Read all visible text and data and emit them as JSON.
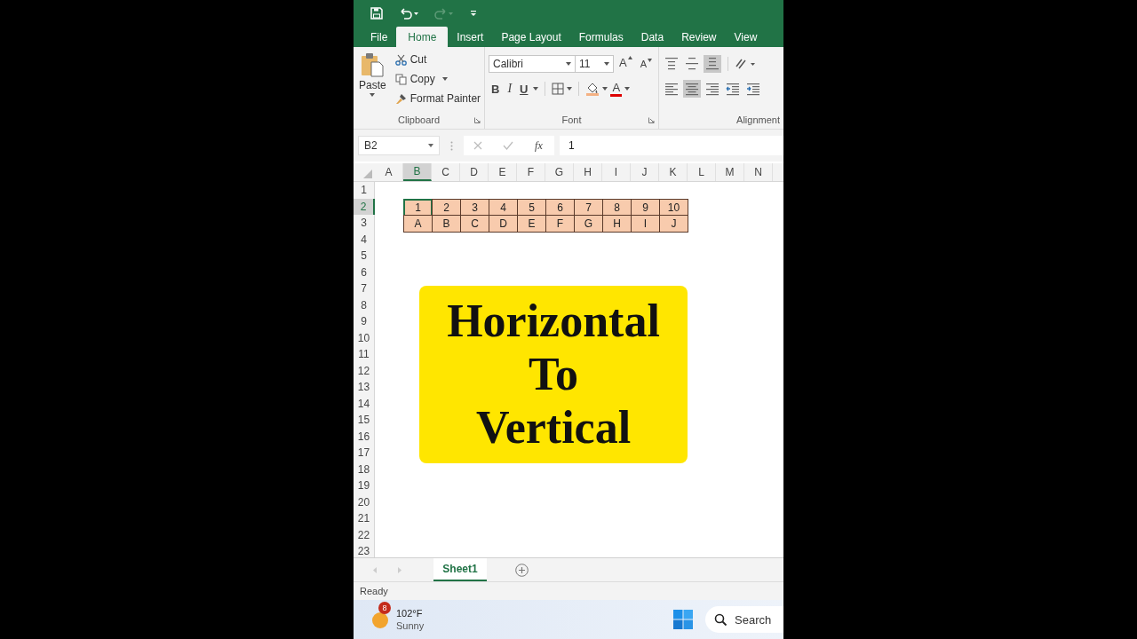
{
  "tabs": [
    {
      "label": "File",
      "selected": false
    },
    {
      "label": "Home",
      "selected": true
    },
    {
      "label": "Insert",
      "selected": false
    },
    {
      "label": "Page Layout",
      "selected": false
    },
    {
      "label": "Formulas",
      "selected": false
    },
    {
      "label": "Data",
      "selected": false
    },
    {
      "label": "Review",
      "selected": false
    },
    {
      "label": "View",
      "selected": false
    }
  ],
  "clipboard": {
    "paste": "Paste",
    "cut": "Cut",
    "copy": "Copy",
    "format_painter": "Format Painter",
    "label": "Clipboard"
  },
  "font": {
    "font_name": "Calibri",
    "font_size": "11",
    "size_buttons": [
      {
        "kind": "grow",
        "label": "A"
      },
      {
        "kind": "shrink",
        "label": "A"
      }
    ],
    "format_buttons": [
      "B",
      "I",
      "U"
    ],
    "font_color": "A",
    "label": "Font"
  },
  "alignment": {
    "top_row": [
      {
        "kind": "top",
        "selected": false
      },
      {
        "kind": "middle",
        "selected": false
      },
      {
        "kind": "bottom",
        "selected": true
      }
    ],
    "bottom_row": [
      {
        "kind": "left",
        "selected": false
      },
      {
        "kind": "center",
        "selected": true
      },
      {
        "kind": "right",
        "selected": false
      },
      {
        "kind": "outdent",
        "selected": false
      },
      {
        "kind": "indent",
        "selected": false
      }
    ],
    "label": "Alignment"
  },
  "formula_bar": {
    "name_box": "B2",
    "function_label": "fx",
    "value": "1"
  },
  "sheet": {
    "columns": [
      {
        "label": "A",
        "selected": false
      },
      {
        "label": "B",
        "selected": true
      },
      {
        "label": "C",
        "selected": false
      },
      {
        "label": "D",
        "selected": false
      },
      {
        "label": "E",
        "selected": false
      },
      {
        "label": "F",
        "selected": false
      },
      {
        "label": "G",
        "selected": false
      },
      {
        "label": "H",
        "selected": false
      },
      {
        "label": "I",
        "selected": false
      },
      {
        "label": "J",
        "selected": false
      },
      {
        "label": "K",
        "selected": false
      },
      {
        "label": "L",
        "selected": false
      },
      {
        "label": "M",
        "selected": false
      },
      {
        "label": "N",
        "selected": false
      }
    ],
    "rows": [
      {
        "label": "1",
        "selected": false
      },
      {
        "label": "2",
        "selected": true,
        "cells": [
          null,
          {
            "value": "1",
            "selected": true
          },
          {
            "value": "2",
            "selected": false
          },
          {
            "value": "3",
            "selected": false
          },
          {
            "value": "4",
            "selected": false
          },
          {
            "value": "5",
            "selected": false
          },
          {
            "value": "6",
            "selected": false
          },
          {
            "value": "7",
            "selected": false
          },
          {
            "value": "8",
            "selected": false
          },
          {
            "value": "9",
            "selected": false
          },
          {
            "value": "10",
            "selected": false
          }
        ]
      },
      {
        "label": "3",
        "selected": false,
        "cells": [
          null,
          {
            "value": "A",
            "selected": false
          },
          {
            "value": "B",
            "selected": false
          },
          {
            "value": "C",
            "selected": false
          },
          {
            "value": "D",
            "selected": false
          },
          {
            "value": "E",
            "selected": false
          },
          {
            "value": "F",
            "selected": false
          },
          {
            "value": "G",
            "selected": false
          },
          {
            "value": "H",
            "selected": false
          },
          {
            "value": "I",
            "selected": false
          },
          {
            "value": "J",
            "selected": false
          }
        ]
      },
      {
        "label": "4",
        "selected": false
      },
      {
        "label": "5",
        "selected": false
      },
      {
        "label": "6",
        "selected": false
      },
      {
        "label": "7",
        "selected": false
      },
      {
        "label": "8",
        "selected": false
      },
      {
        "label": "9",
        "selected": false
      },
      {
        "label": "10",
        "selected": false
      },
      {
        "label": "11",
        "selected": false
      },
      {
        "label": "12",
        "selected": false
      },
      {
        "label": "13",
        "selected": false
      },
      {
        "label": "14",
        "selected": false
      },
      {
        "label": "15",
        "selected": false
      },
      {
        "label": "16",
        "selected": false
      },
      {
        "label": "17",
        "selected": false
      },
      {
        "label": "18",
        "selected": false
      },
      {
        "label": "19",
        "selected": false
      },
      {
        "label": "20",
        "selected": false
      },
      {
        "label": "21",
        "selected": false
      },
      {
        "label": "22",
        "selected": false
      },
      {
        "label": "23",
        "selected": false
      }
    ]
  },
  "overlay_title": {
    "lines": [
      "Horizontal",
      "To",
      "Vertical"
    ]
  },
  "sheet_tabs": [
    {
      "label": "Sheet1",
      "selected": true
    }
  ],
  "status_bar": "Ready",
  "taskbar": {
    "weather": {
      "badge": "8",
      "temperature": "102°F",
      "condition": "Sunny"
    },
    "search": {
      "placeholder": "Search"
    }
  }
}
